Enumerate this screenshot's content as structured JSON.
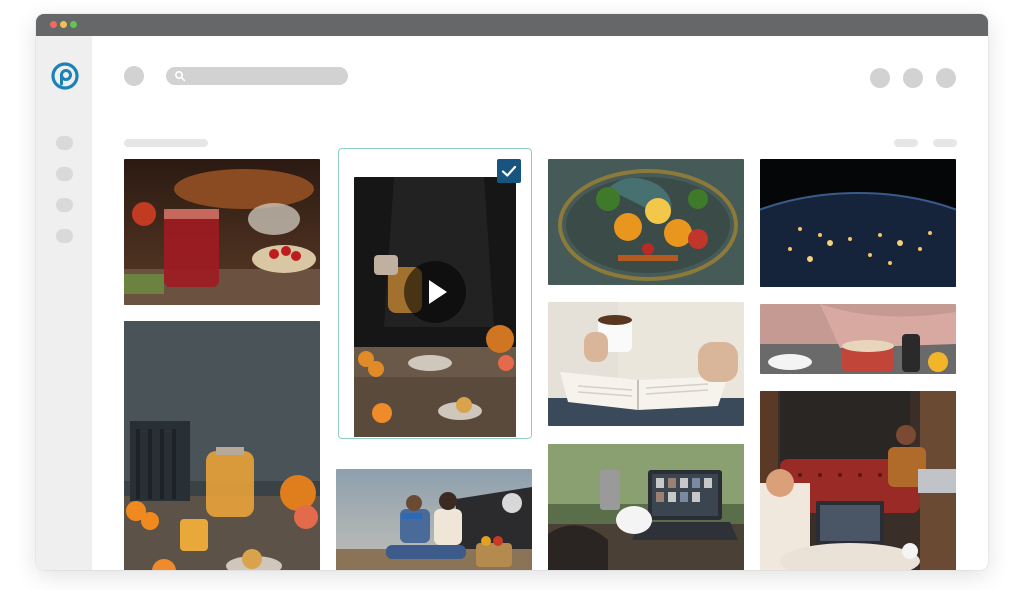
{
  "window": {
    "titlebar_color": "#666769"
  },
  "brand": {
    "accent": "#1b82b8",
    "logo_icon": "photo-app-logo-icon"
  },
  "sidebar": {
    "items": [
      {
        "icon": "nav-dot"
      },
      {
        "icon": "nav-dot"
      },
      {
        "icon": "nav-dot"
      },
      {
        "icon": "nav-dot"
      }
    ]
  },
  "toolbar": {
    "search": {
      "placeholder": "",
      "icon": "search-icon"
    },
    "action_icons": [
      "action-dot",
      "action-dot",
      "action-dot"
    ]
  },
  "gallery": {
    "selection_color": "#17557f",
    "selection_border": "#8fd0c2",
    "tiles": [
      {
        "id": "tea-rosehip",
        "selected": false,
        "is_video": false
      },
      {
        "id": "tea-teapot-table",
        "selected": false,
        "is_video": false
      },
      {
        "id": "tea-pour-video",
        "selected": true,
        "is_video": true
      },
      {
        "id": "picnic-couple",
        "selected": false,
        "is_video": false
      },
      {
        "id": "tray-drinks",
        "selected": false,
        "is_video": false
      },
      {
        "id": "reading-coffee",
        "selected": false,
        "is_video": false
      },
      {
        "id": "laptop-coffee",
        "selected": false,
        "is_video": false
      },
      {
        "id": "earth-night",
        "selected": false,
        "is_video": false
      },
      {
        "id": "cozy-blanket-cup",
        "selected": false,
        "is_video": false
      },
      {
        "id": "cafe-laptops",
        "selected": false,
        "is_video": false
      }
    ]
  }
}
